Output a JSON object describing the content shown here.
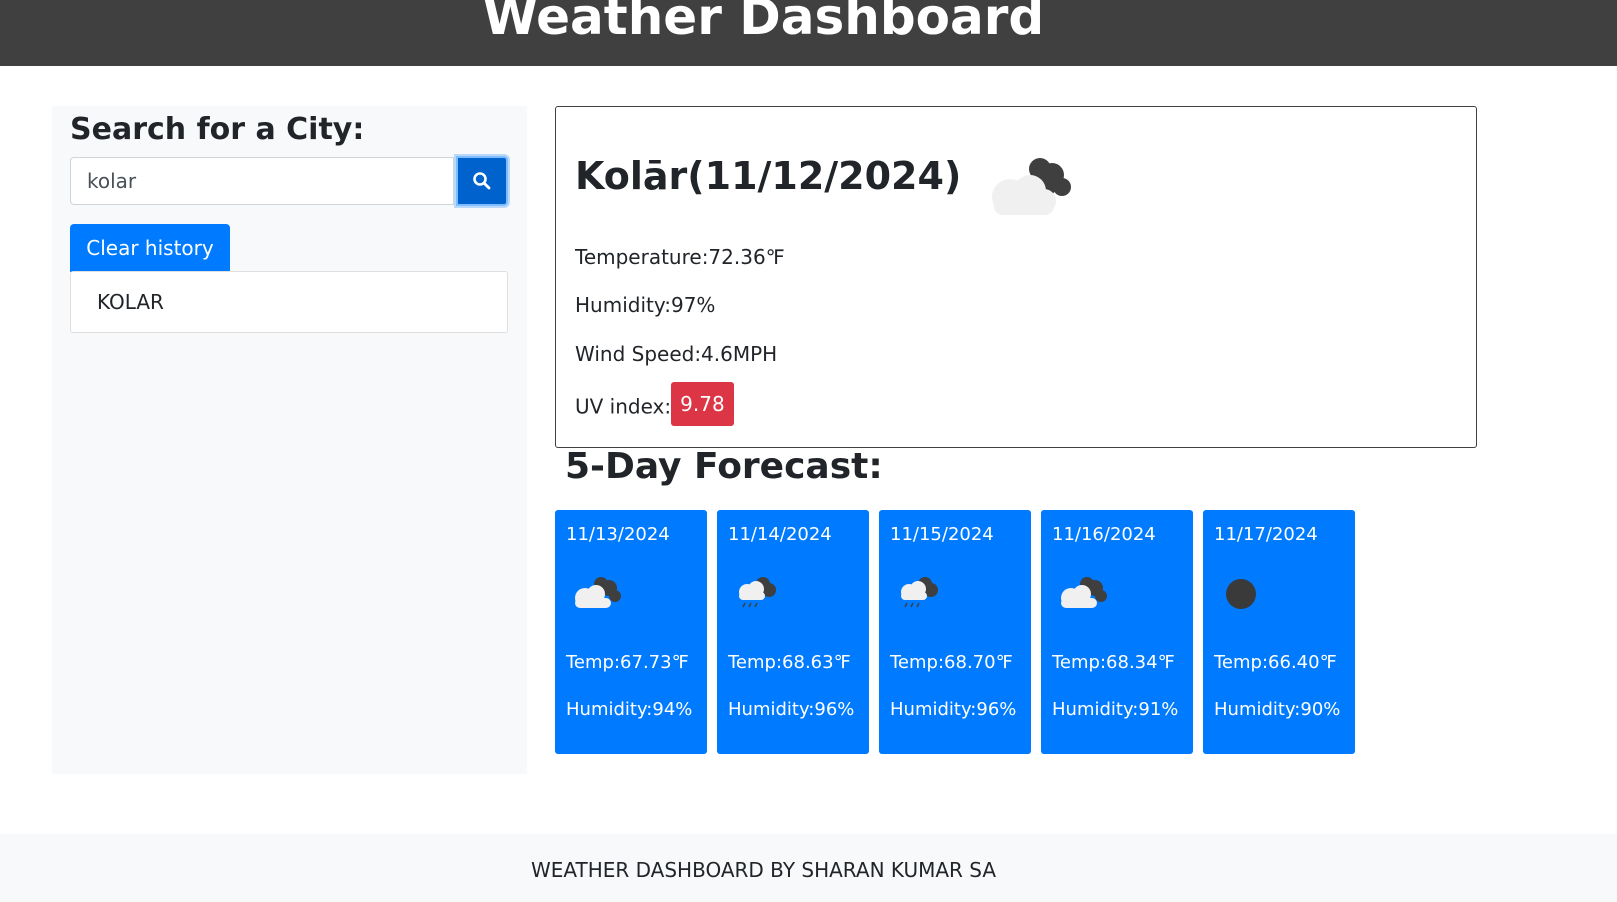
{
  "header": {
    "title": "Weather Dashboard"
  },
  "sidebar": {
    "heading": "Search for a City:",
    "search": {
      "value": "kolar",
      "placeholder": ""
    },
    "search_button_icon": "search-icon",
    "clear_label": "Clear history",
    "history": [
      "KOLAR"
    ]
  },
  "current": {
    "title": "Kolār(11/12/2024)",
    "icon": "broken-clouds-icon",
    "temperature": "Temperature:72.36℉",
    "humidity": "Humidity:97%",
    "wind": "Wind Speed:4.6MPH",
    "uv_label": "UV index:",
    "uv_value": "9.78"
  },
  "forecast": {
    "title": "5-Day Forecast:",
    "days": [
      {
        "date": "11/13/2024",
        "icon": "broken-clouds-icon",
        "temp": "Temp:67.73℉",
        "humidity": "Humidity:94%"
      },
      {
        "date": "11/14/2024",
        "icon": "rain-icon",
        "temp": "Temp:68.63℉",
        "humidity": "Humidity:96%"
      },
      {
        "date": "11/15/2024",
        "icon": "rain-icon",
        "temp": "Temp:68.70℉",
        "humidity": "Humidity:96%"
      },
      {
        "date": "11/16/2024",
        "icon": "broken-clouds-icon",
        "temp": "Temp:68.34℉",
        "humidity": "Humidity:91%"
      },
      {
        "date": "11/17/2024",
        "icon": "dark-circle-icon",
        "temp": "Temp:66.40℉",
        "humidity": "Humidity:90%"
      }
    ]
  },
  "footer": {
    "text": "WEATHER DASHBOARD BY SHARAN KUMAR SA"
  },
  "colors": {
    "header_bg": "#404040",
    "primary": "#007bff",
    "primary_dark": "#0062cc",
    "danger": "#dc3545",
    "light": "#f8f9fa"
  }
}
